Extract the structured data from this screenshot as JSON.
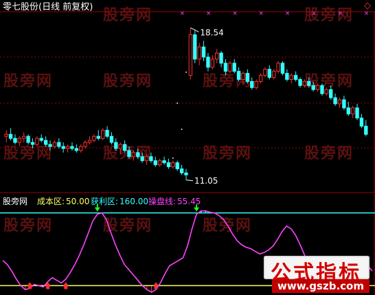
{
  "header": {
    "title": "零七股份(日线 前复权)",
    "corner_icon": "diamond-icon"
  },
  "indicator_header": {
    "source": "股旁网",
    "items": [
      {
        "label": "成本区:",
        "value": "50.00",
        "color": "#ffff66"
      },
      {
        "label": "获利区:",
        "value": "160.00",
        "color": "#33ffff"
      },
      {
        "label": "操盘线:",
        "value": "55.45",
        "color": "#ff44ff"
      }
    ]
  },
  "watermarks": {
    "text": "股旁网"
  },
  "logo": {
    "title": "公式指标",
    "url": "www.gszb.com"
  },
  "chart_data": [
    {
      "type": "candlestick",
      "title": "零七股份(日线 前复权)",
      "annotations": [
        {
          "text": "18.54",
          "kind": "high"
        },
        {
          "text": "11.05",
          "kind": "low"
        }
      ],
      "ylim": [
        10.5,
        19.3
      ],
      "colors": {
        "up": "#ff3030",
        "down": "#33ffff",
        "grid": "#a00000",
        "marker": "#ff44ff"
      },
      "candles": [
        [
          13.2,
          13.5,
          12.9,
          13.3
        ],
        [
          13.3,
          13.6,
          13.0,
          13.1
        ],
        [
          13.1,
          13.3,
          12.8,
          12.9
        ],
        [
          12.9,
          13.2,
          12.7,
          13.1
        ],
        [
          13.1,
          13.4,
          12.9,
          13.2
        ],
        [
          13.2,
          13.3,
          12.8,
          12.9
        ],
        [
          12.9,
          13.1,
          12.6,
          12.8
        ],
        [
          12.8,
          13.2,
          12.7,
          13.1
        ],
        [
          13.1,
          13.3,
          12.9,
          13.0
        ],
        [
          13.0,
          13.2,
          12.7,
          12.8
        ],
        [
          12.8,
          13.0,
          12.5,
          12.7
        ],
        [
          12.7,
          13.0,
          12.6,
          12.9
        ],
        [
          12.9,
          13.1,
          12.6,
          12.7
        ],
        [
          12.7,
          12.9,
          12.4,
          12.6
        ],
        [
          12.6,
          12.8,
          12.4,
          12.7
        ],
        [
          12.7,
          12.9,
          12.5,
          12.6
        ],
        [
          12.6,
          12.8,
          12.4,
          12.5
        ],
        [
          12.5,
          12.8,
          12.4,
          12.7
        ],
        [
          12.7,
          13.0,
          12.6,
          12.9
        ],
        [
          12.9,
          13.2,
          12.8,
          13.0
        ],
        [
          13.0,
          13.3,
          12.9,
          13.2
        ],
        [
          13.2,
          13.5,
          13.0,
          13.1
        ],
        [
          13.1,
          13.6,
          13.0,
          13.5
        ],
        [
          13.5,
          13.7,
          13.1,
          13.2
        ],
        [
          13.2,
          13.4,
          12.8,
          12.9
        ],
        [
          12.9,
          13.1,
          12.5,
          12.6
        ],
        [
          12.6,
          12.9,
          12.3,
          12.8
        ],
        [
          12.8,
          13.0,
          12.4,
          12.5
        ],
        [
          12.5,
          12.7,
          12.1,
          12.2
        ],
        [
          12.2,
          12.5,
          12.0,
          12.4
        ],
        [
          12.4,
          12.6,
          12.1,
          12.2
        ],
        [
          12.2,
          12.4,
          11.9,
          12.0
        ],
        [
          12.0,
          12.3,
          11.8,
          12.2
        ],
        [
          12.2,
          12.4,
          11.9,
          12.0
        ],
        [
          12.0,
          12.2,
          11.7,
          11.8
        ],
        [
          11.8,
          12.1,
          11.7,
          12.0
        ],
        [
          12.0,
          12.2,
          11.8,
          11.9
        ],
        [
          11.9,
          12.1,
          11.6,
          11.7
        ],
        [
          11.7,
          12.0,
          11.6,
          11.9
        ],
        [
          11.9,
          12.0,
          11.5,
          11.6
        ],
        [
          11.6,
          11.8,
          11.3,
          11.4
        ],
        [
          11.4,
          11.6,
          11.05,
          11.3
        ],
        [
          16.2,
          18.54,
          16.0,
          18.2
        ],
        [
          18.2,
          18.4,
          16.8,
          17.0
        ],
        [
          17.0,
          17.8,
          16.7,
          17.6
        ],
        [
          17.6,
          17.9,
          16.9,
          17.1
        ],
        [
          17.1,
          17.3,
          16.4,
          16.6
        ],
        [
          16.6,
          17.2,
          16.5,
          17.0
        ],
        [
          17.0,
          17.5,
          16.8,
          17.3
        ],
        [
          17.3,
          17.4,
          16.6,
          16.8
        ],
        [
          16.8,
          17.0,
          16.2,
          16.4
        ],
        [
          16.4,
          16.9,
          16.3,
          16.8
        ],
        [
          16.8,
          17.0,
          16.3,
          16.4
        ],
        [
          16.4,
          16.6,
          15.9,
          16.0
        ],
        [
          16.0,
          16.4,
          15.8,
          16.3
        ],
        [
          16.3,
          16.5,
          15.8,
          15.9
        ],
        [
          15.9,
          16.1,
          15.5,
          15.6
        ],
        [
          15.6,
          16.0,
          15.5,
          15.9
        ],
        [
          15.9,
          16.3,
          15.8,
          16.2
        ],
        [
          16.2,
          16.6,
          16.1,
          16.5
        ],
        [
          16.5,
          16.7,
          16.0,
          16.1
        ],
        [
          16.1,
          16.5,
          16.0,
          16.4
        ],
        [
          16.4,
          16.9,
          16.3,
          16.8
        ],
        [
          16.8,
          16.9,
          16.2,
          16.3
        ],
        [
          16.3,
          16.5,
          15.9,
          16.0
        ],
        [
          16.0,
          16.3,
          15.8,
          16.2
        ],
        [
          16.2,
          16.4,
          15.9,
          16.0
        ],
        [
          16.0,
          16.1,
          15.6,
          15.7
        ],
        [
          15.7,
          16.0,
          15.6,
          15.9
        ],
        [
          15.9,
          16.1,
          15.6,
          15.7
        ],
        [
          15.7,
          15.9,
          15.4,
          15.5
        ],
        [
          15.5,
          15.8,
          15.4,
          15.7
        ],
        [
          15.7,
          15.8,
          15.2,
          15.3
        ],
        [
          15.3,
          15.6,
          15.2,
          15.5
        ],
        [
          15.5,
          15.7,
          15.0,
          15.1
        ],
        [
          15.1,
          15.3,
          14.7,
          14.8
        ],
        [
          14.8,
          15.1,
          14.6,
          15.0
        ],
        [
          15.0,
          15.2,
          14.5,
          14.6
        ],
        [
          14.6,
          14.9,
          14.2,
          14.3
        ],
        [
          14.3,
          14.7,
          14.1,
          14.6
        ],
        [
          14.6,
          14.8,
          14.0,
          14.1
        ],
        [
          14.1,
          14.3,
          13.6,
          13.7
        ],
        [
          13.7,
          14.0,
          13.2,
          13.3
        ]
      ]
    },
    {
      "type": "line",
      "title": "",
      "ylim": [
        40,
        170
      ],
      "reference_lines": [
        {
          "name": "成本区",
          "value": 50.0,
          "color": "#ffff66"
        },
        {
          "name": "获利区",
          "value": 160.0,
          "color": "#33ffff"
        }
      ],
      "series": [
        {
          "name": "操盘线",
          "color": "#ff44ff",
          "values": [
            88,
            82,
            72,
            60,
            50,
            44,
            46,
            52,
            50,
            48,
            56,
            62,
            58,
            54,
            60,
            70,
            82,
            96,
            112,
            130,
            148,
            158,
            160,
            150,
            130,
            112,
            96,
            82,
            74,
            66,
            58,
            50,
            44,
            40,
            44,
            54,
            68,
            80,
            84,
            88,
            92,
            110,
            136,
            158,
            163,
            163,
            161,
            160,
            156,
            150,
            140,
            128,
            118,
            112,
            108,
            106,
            102,
            98,
            100,
            104,
            110,
            120,
            132,
            140,
            136,
            126,
            112,
            96,
            82,
            70,
            60,
            52,
            48,
            52,
            58,
            66,
            74,
            82,
            88,
            90,
            86,
            80,
            72
          ]
        }
      ],
      "markers": {
        "green_arrows": [
          "top",
          "top"
        ],
        "red_arrows_count": 6
      }
    }
  ]
}
